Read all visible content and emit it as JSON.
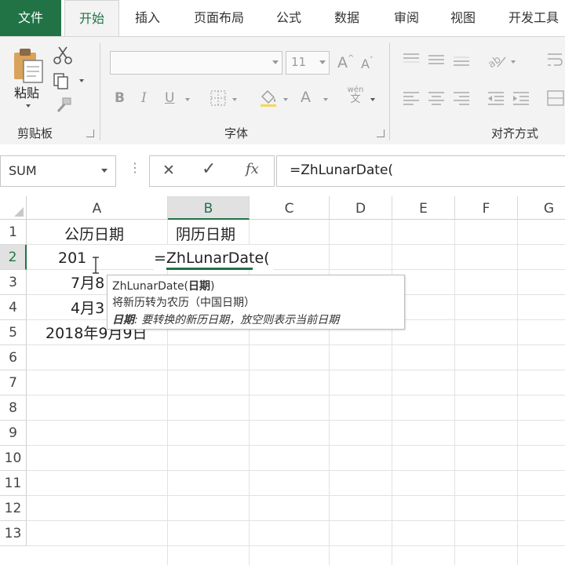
{
  "tabs": {
    "file": "文件",
    "home": "开始",
    "insert": "插入",
    "page_layout": "页面布局",
    "formulas": "公式",
    "data": "数据",
    "review": "审阅",
    "view": "视图",
    "developer": "开发工具"
  },
  "ribbon": {
    "paste_label": "粘贴",
    "clipboard_label": "剪贴板",
    "font_group_label": "字体",
    "font_size": "11",
    "align_group_label": "对齐方式",
    "bold": "B",
    "italic": "I",
    "underline": "U",
    "font_color": "A",
    "grow_font": "A",
    "shrink_font": "A",
    "phonetic_top": "wén",
    "phonetic_bottom": "文"
  },
  "formula_bar": {
    "name_box": "SUM",
    "cancel_symbol": "✕",
    "enter_symbol": "✓",
    "fx_symbol": "fx",
    "formula": "=ZhLunarDate("
  },
  "grid": {
    "columns": [
      "A",
      "B",
      "C",
      "D",
      "E",
      "F",
      "G"
    ],
    "rows": [
      "1",
      "2",
      "3",
      "4",
      "5",
      "6",
      "7",
      "8",
      "9",
      "10",
      "11",
      "12",
      "13"
    ],
    "cells": {
      "A1": "公历日期",
      "B1": "阴历日期",
      "A2": "201",
      "B2": "=ZhLunarDate(",
      "A3": "7月8",
      "A4": "4月3",
      "A5": "2018年9月9日"
    },
    "active_column": "B",
    "active_row": "2"
  },
  "tooltip": {
    "func_name": "ZhLunarDate(",
    "func_arg": "日期",
    "func_close": ")",
    "description": "将新历转为农历（中国日期）",
    "arg_name": "日期",
    "arg_desc": ": 要转换的新历日期，放空则表示当前日期"
  },
  "colors": {
    "accent": "#217346",
    "ribbon_bg": "#f3f3f3",
    "grid_line": "#e2e2e2"
  }
}
